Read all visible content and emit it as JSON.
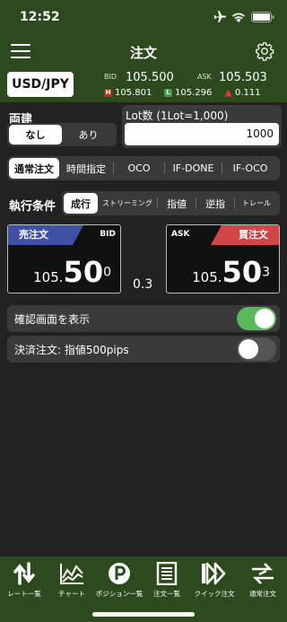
{
  "status": {
    "time": "12:52"
  },
  "nav": {
    "title": "注文"
  },
  "price": {
    "pair": "USD/JPY",
    "bid_label": "BID",
    "bid": "105.500",
    "ask_label": "ASK",
    "ask": "105.503",
    "high_badge": "H",
    "high": "105.801",
    "low_badge": "L",
    "low": "105.296",
    "change": "0.111"
  },
  "side": {
    "label": "両建",
    "options": [
      "なし",
      "あり"
    ],
    "selected": "なし"
  },
  "lot": {
    "label": "Lot数 (1Lot=1,000)",
    "value": "1000"
  },
  "order_types": {
    "options": [
      "通常注文",
      "時間指定",
      "OCO",
      "IF-DONE",
      "IF-OCO"
    ],
    "selected": "通常注文"
  },
  "exec": {
    "label": "執行条件",
    "options": [
      "成行",
      "ストリーミング",
      "指値",
      "逆指",
      "トレール"
    ],
    "selected": "成行"
  },
  "sell": {
    "tag": "売注文",
    "side": "BID",
    "small": "105.",
    "large": "50",
    "sup": "0"
  },
  "buy": {
    "tag": "買注文",
    "side": "ASK",
    "small": "105.",
    "large": "50",
    "sup": "3"
  },
  "spread": "0.3",
  "confirm": {
    "label": "確認画面を表示",
    "on": true
  },
  "settle": {
    "label": "決済注文: 指値500pips",
    "on": false
  },
  "tabs": [
    {
      "label": "レート一覧",
      "icon": "rate-list-icon"
    },
    {
      "label": "チャート",
      "icon": "chart-icon"
    },
    {
      "label": "ポジション一覧",
      "icon": "position-icon"
    },
    {
      "label": "注文一覧",
      "icon": "order-list-icon"
    },
    {
      "label": "クイック注文",
      "icon": "quick-order-icon"
    },
    {
      "label": "通常注文",
      "icon": "normal-order-icon"
    }
  ],
  "colors": {
    "bar": "#2d4a1e",
    "toggle_on": "#5cb85c",
    "sell": "#3f51a5",
    "buy": "#d04545",
    "background": "#222222"
  }
}
